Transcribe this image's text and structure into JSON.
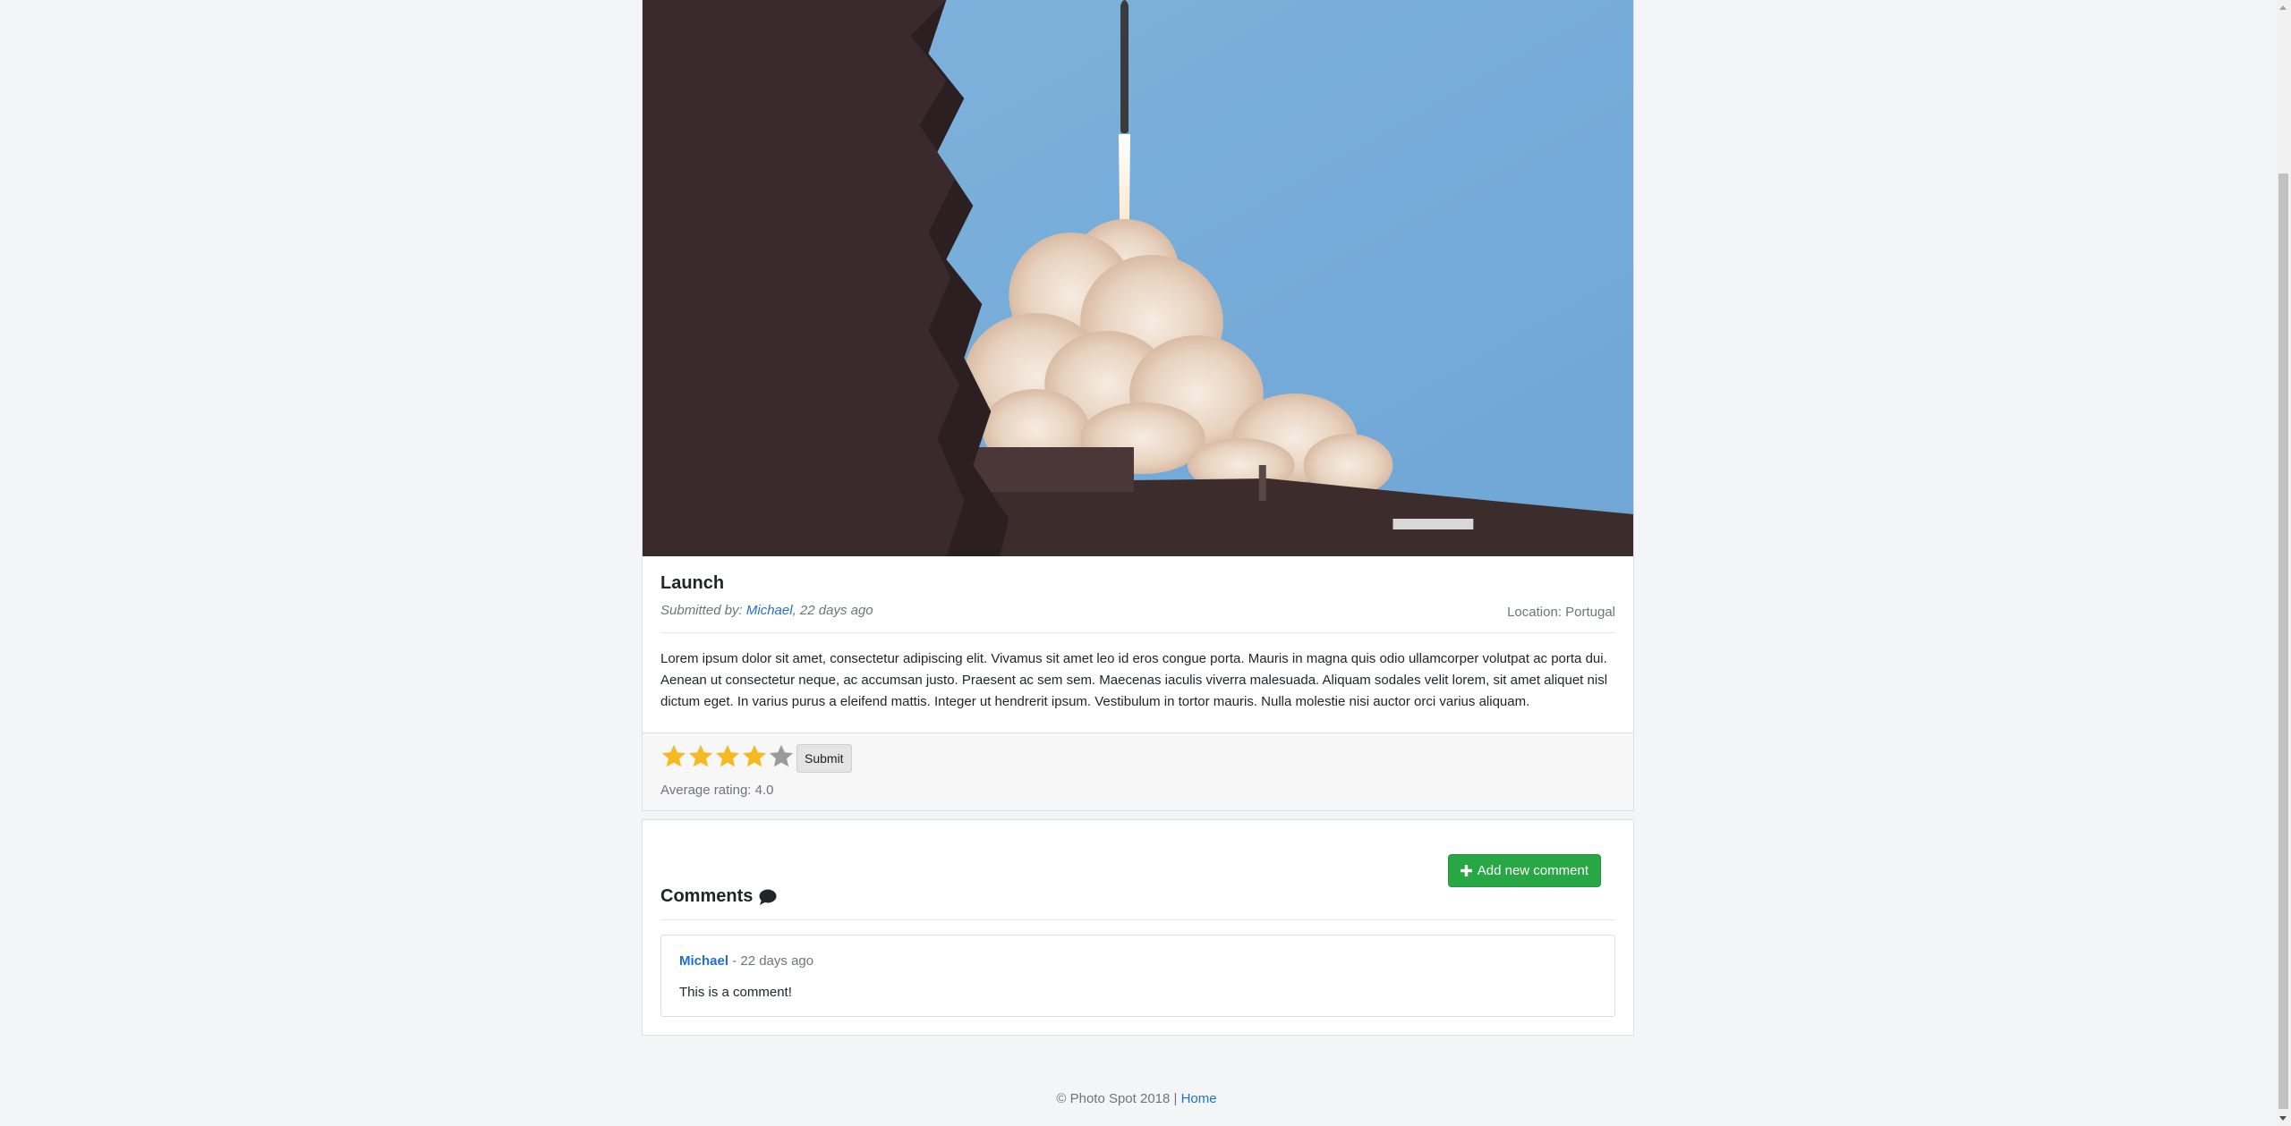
{
  "photo": {
    "title": "Launch",
    "submitted_prefix": "Submitted by: ",
    "author": "Michael",
    "submitted_suffix": ", 22 days ago",
    "location": "Location: Portugal",
    "description": "Lorem ipsum dolor sit amet, consectetur adipiscing elit. Vivamus sit amet leo id eros congue porta. Mauris in magna quis odio ullamcorper volutpat ac porta dui. Aenean ut consectetur neque, ac accumsan justo. Praesent ac sem sem. Maecenas iaculis viverra malesuada. Aliquam sodales velit lorem, sit amet aliquet nisl dictum eget. In varius purus a eleifend mattis. Integer ut hendrerit ipsum. Vestibulum in tortor mauris. Nulla molestie nisi auctor orci varius aliquam."
  },
  "rating": {
    "selected": 4,
    "max": 5,
    "submit_label": "Submit",
    "average_label": "Average rating: 4.0",
    "colors": {
      "filled": "#f5b921",
      "empty": "#9a9a9a"
    }
  },
  "comments": {
    "heading": "Comments",
    "add_label": "Add new comment",
    "items": [
      {
        "author": "Michael",
        "meta": " - 22 days ago",
        "text": "This is a comment!"
      }
    ]
  },
  "footer": {
    "copyright": "© Photo Spot 2018 | ",
    "home_link": "Home"
  },
  "colors": {
    "accent_link": "#1f6fd1",
    "success": "#28a745",
    "background": "#f4f5f7"
  }
}
